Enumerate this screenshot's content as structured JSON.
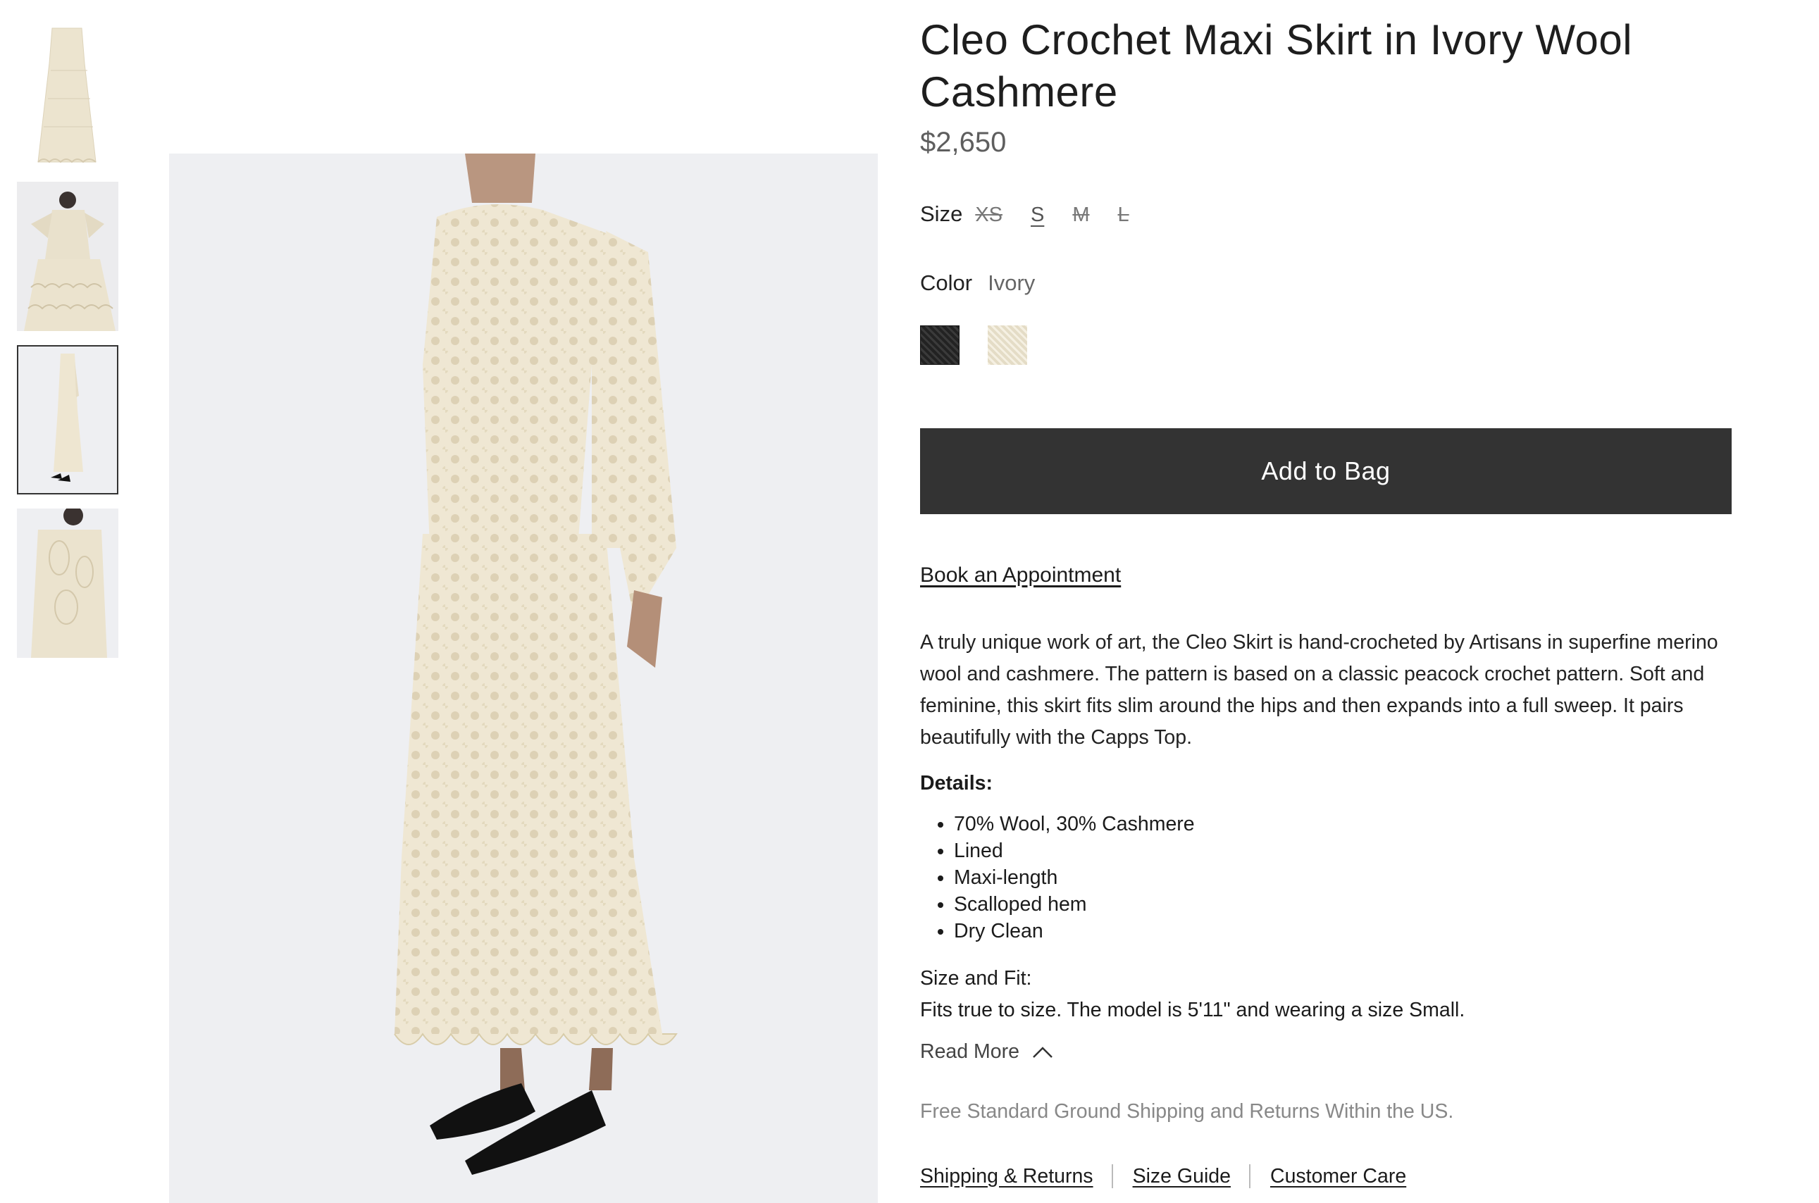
{
  "thumbnails": [
    {
      "alt": "skirt-flat-thumbnail"
    },
    {
      "alt": "model-seated-thumbnail"
    },
    {
      "alt": "model-side-thumbnail"
    },
    {
      "alt": "model-closeup-thumbnail"
    }
  ],
  "product": {
    "title": "Cleo Crochet Maxi Skirt in Ivory Wool Cashmere",
    "price": "$2,650"
  },
  "size": {
    "label": "Size",
    "options": [
      {
        "label": "XS",
        "available": false
      },
      {
        "label": "S",
        "available": true
      },
      {
        "label": "M",
        "available": false
      },
      {
        "label": "L",
        "available": false
      }
    ]
  },
  "color": {
    "label": "Color",
    "value": "Ivory",
    "swatches": [
      {
        "name": "Black",
        "color": "#2a2a2a"
      },
      {
        "name": "Ivory",
        "color": "#efe8d6"
      }
    ]
  },
  "add_to_bag": "Add to Bag",
  "book_appointment": "Book an Appointment",
  "description": "A truly unique work of art, the Cleo Skirt is hand-crocheted by Artisans in superfine merino wool and cashmere. The pattern is based on a classic peacock crochet pattern. Soft and feminine, this skirt fits slim around the hips and then expands into a full sweep. It pairs beautifully with the Capps Top.",
  "details": {
    "heading": "Details:",
    "items": [
      "70% Wool, 30% Cashmere",
      "Lined",
      "Maxi-length",
      "Scalloped hem",
      "Dry Clean"
    ]
  },
  "size_fit": {
    "heading": "Size and Fit:",
    "text": "Fits true to size. The model is 5'11\" and wearing a size Small."
  },
  "read_more": "Read More",
  "shipping_note": "Free Standard Ground Shipping and Returns Within the US.",
  "footer_links": [
    "Shipping & Returns",
    "Size Guide",
    "Customer Care"
  ],
  "colors": {
    "button_bg": "#333333",
    "image_bg": "#eeeff2",
    "garment": "#efe7d3"
  }
}
